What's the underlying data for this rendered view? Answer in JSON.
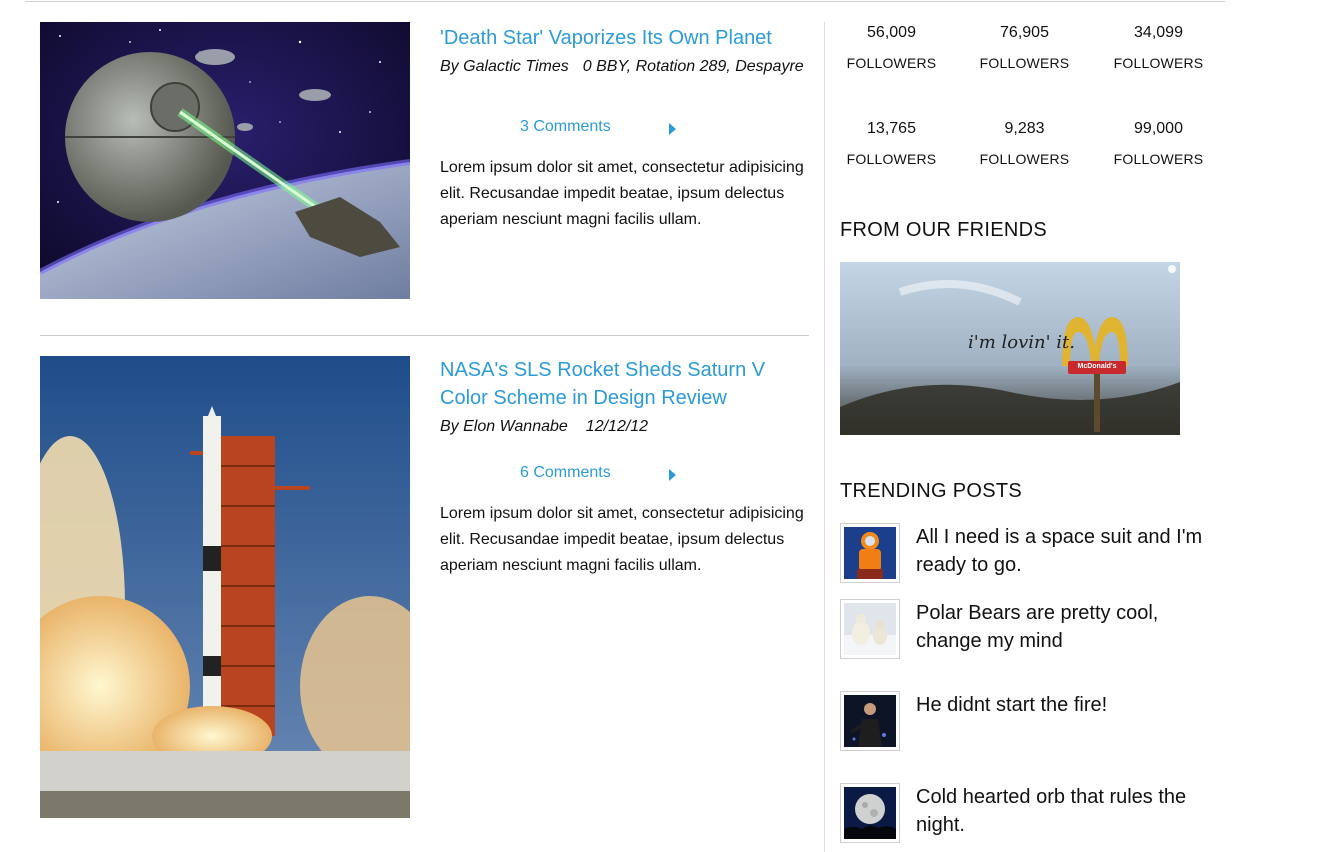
{
  "articles": [
    {
      "title": "'Death Star' Vaporizes Its Own Planet",
      "author": "By Galactic Times",
      "date": "0 BBY, Rotation 289, Despayre",
      "comments": "3 Comments",
      "excerpt": "Lorem ipsum dolor sit amet, consectetur adipisicing elit. Recusandae impedit beatae, ipsum delectus aperiam nesciunt magni facilis ullam."
    },
    {
      "title": "NASA's SLS Rocket Sheds Saturn V Color Scheme in Design Review",
      "author": "By Elon Wannabe",
      "date": "12/12/12",
      "comments": "6 Comments",
      "excerpt": "Lorem ipsum dolor sit amet, consectetur adipisicing elit. Recusandae impedit beatae, ipsum delectus aperiam nesciunt magni facilis ullam."
    }
  ],
  "followers": [
    {
      "count": "56,009",
      "label": "FOLLOWERS"
    },
    {
      "count": "76,905",
      "label": "FOLLOWERS"
    },
    {
      "count": "34,099",
      "label": "FOLLOWERS"
    },
    {
      "count": "13,765",
      "label": "FOLLOWERS"
    },
    {
      "count": "9,283",
      "label": "FOLLOWERS"
    },
    {
      "count": "99,000",
      "label": "FOLLOWERS"
    }
  ],
  "friends": {
    "heading": "FROM OUR FRIENDS",
    "ad_slogan": "i'm lovin' it.",
    "ad_brand": "McDonald's"
  },
  "trending": {
    "heading": "TRENDING POSTS",
    "posts": [
      {
        "title": "All I need is a space suit and I'm ready to go.",
        "icon": "astronaut-image"
      },
      {
        "title": "Polar Bears are pretty cool, change my mind",
        "icon": "polar-bears-image"
      },
      {
        "title": "He didnt start the fire!",
        "icon": "singer-image"
      },
      {
        "title": "Cold hearted orb that rules the night.",
        "icon": "moon-image"
      }
    ]
  },
  "colors": {
    "link": "#2b9bd6",
    "text": "#111111",
    "divider": "#cccccc"
  }
}
